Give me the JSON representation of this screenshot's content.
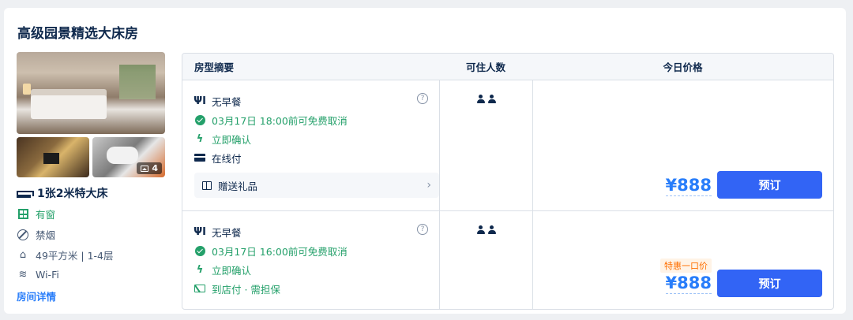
{
  "room": {
    "title": "高级园景精选大床房",
    "photo_count": "4",
    "bed": "1张2米特大床",
    "window": "有窗",
    "smoking": "禁烟",
    "area_floor": "49平方米 | 1-4层",
    "wifi": "Wi-Fi",
    "details_link": "房间详情"
  },
  "table": {
    "headers": [
      "房型摘要",
      "可住人数",
      "今日价格"
    ],
    "rows": [
      {
        "meal": "无早餐",
        "cancel": "03月17日 18:00前可免费取消",
        "confirm": "立即确认",
        "payment": "在线付",
        "gift": "赠送礼品",
        "occupancy": 2,
        "tag": "",
        "price": "¥888",
        "book_label": "预订"
      },
      {
        "meal": "无早餐",
        "cancel": "03月17日 16:00前可免费取消",
        "confirm": "立即确认",
        "payment": "到店付 · 需担保",
        "tag": "特惠一口价",
        "occupancy": 2,
        "price": "¥888",
        "book_label": "预订"
      }
    ]
  },
  "colors": {
    "accent": "#287dfa",
    "button": "#3264f5",
    "green": "#24a06a",
    "tag": "#ff6f00"
  }
}
